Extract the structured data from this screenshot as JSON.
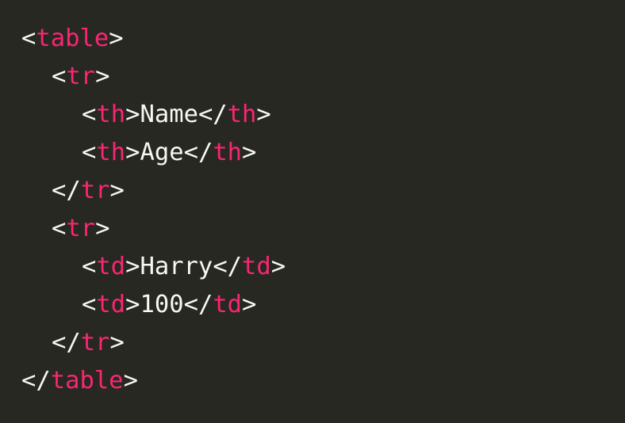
{
  "code": {
    "lines": [
      {
        "open": "<",
        "tag": "table",
        "close": ">"
      },
      {
        "open": "<",
        "tag": "tr",
        "close": ">"
      },
      {
        "open": "<",
        "tag": "th",
        "close": ">",
        "text": "Name",
        "end_open": "</",
        "end_tag": "th",
        "end_close": ">"
      },
      {
        "open": "<",
        "tag": "th",
        "close": ">",
        "text": "Age",
        "end_open": "</",
        "end_tag": "th",
        "end_close": ">"
      },
      {
        "open": "</",
        "tag": "tr",
        "close": ">"
      },
      {
        "open": "<",
        "tag": "tr",
        "close": ">"
      },
      {
        "open": "<",
        "tag": "td",
        "close": ">",
        "text": "Harry",
        "end_open": "</",
        "end_tag": "td",
        "end_close": ">"
      },
      {
        "open": "<",
        "tag": "td",
        "close": ">",
        "text": "100",
        "end_open": "</",
        "end_tag": "td",
        "end_close": ">"
      },
      {
        "open": "</",
        "tag": "tr",
        "close": ">"
      },
      {
        "open": "</",
        "tag": "table",
        "close": ">"
      }
    ]
  },
  "theme": {
    "background": "#272822",
    "tag_color": "#f92672",
    "text_color": "#f8f8f2"
  }
}
